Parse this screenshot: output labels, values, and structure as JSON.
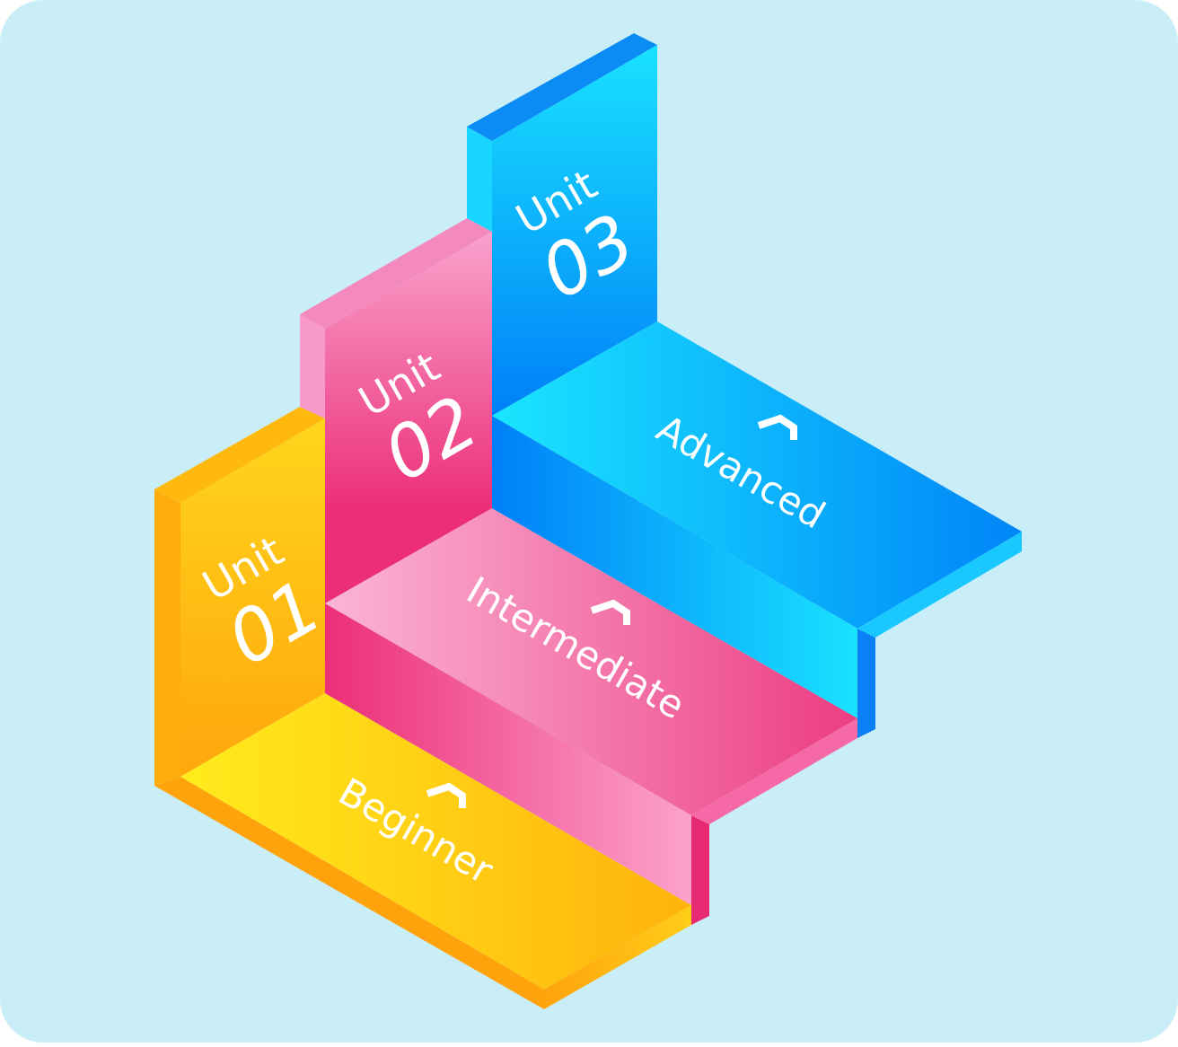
{
  "steps": [
    {
      "unit_word": "Unit",
      "unit_number": "01",
      "level": "Beginner",
      "color": "#ffc20e"
    },
    {
      "unit_word": "Unit",
      "unit_number": "02",
      "level": "Intermediate",
      "color": "#f06aa0"
    },
    {
      "unit_word": "Unit",
      "unit_number": "03",
      "level": "Advanced",
      "color": "#0fb8f5"
    }
  ],
  "colors": {
    "background_panel": "#c9eef8",
    "yellow": "#ffc20e",
    "pink": "#f06aa0",
    "blue": "#0fb8f5"
  },
  "icons": {
    "step_arrow": "chevron-up-icon"
  }
}
